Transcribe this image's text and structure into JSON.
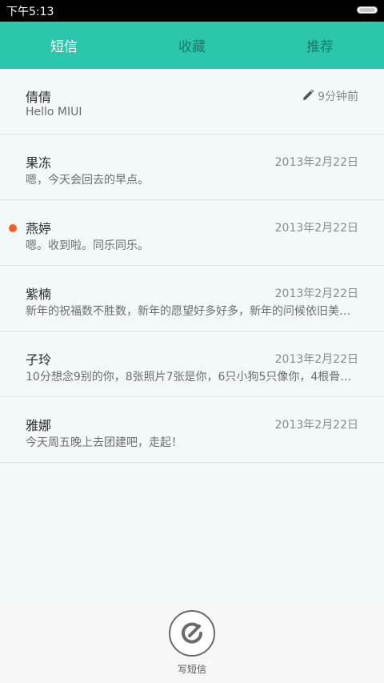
{
  "status_bar": {
    "time": "下午5:13"
  },
  "tabs": [
    {
      "label": "短信",
      "active": true
    },
    {
      "label": "收藏",
      "active": false
    },
    {
      "label": "推荐",
      "active": false
    }
  ],
  "messages": [
    {
      "name": "倩倩",
      "preview": "Hello MIUI",
      "time": "9分钟前",
      "draft": true,
      "unread": false
    },
    {
      "name": "果冻",
      "preview": "嗯，今天会回去的早点。",
      "time": "2013年2月22日",
      "draft": false,
      "unread": false
    },
    {
      "name": "燕婷",
      "preview": "嗯。收到啦。同乐同乐。",
      "time": "2013年2月22日",
      "draft": false,
      "unread": true
    },
    {
      "name": "紫楠",
      "preview": "新年的祝福数不胜数，新年的愿望好多好多，新年的问候依旧美好…",
      "time": "2013年2月22日",
      "draft": false,
      "unread": false
    },
    {
      "name": "子玲",
      "preview": "10分想念9别的你，8张照片7张是你，6只小狗5只像你，4根骨头…",
      "time": "2013年2月22日",
      "draft": false,
      "unread": false
    },
    {
      "name": "雅娜",
      "preview": "今天周五晚上去团建吧，走起！",
      "time": "2013年2月22日",
      "draft": false,
      "unread": false
    }
  ],
  "compose": {
    "label": "写短信"
  },
  "colors": {
    "accent": "#2cc6ad",
    "unread_dot": "#ff5a1f"
  }
}
